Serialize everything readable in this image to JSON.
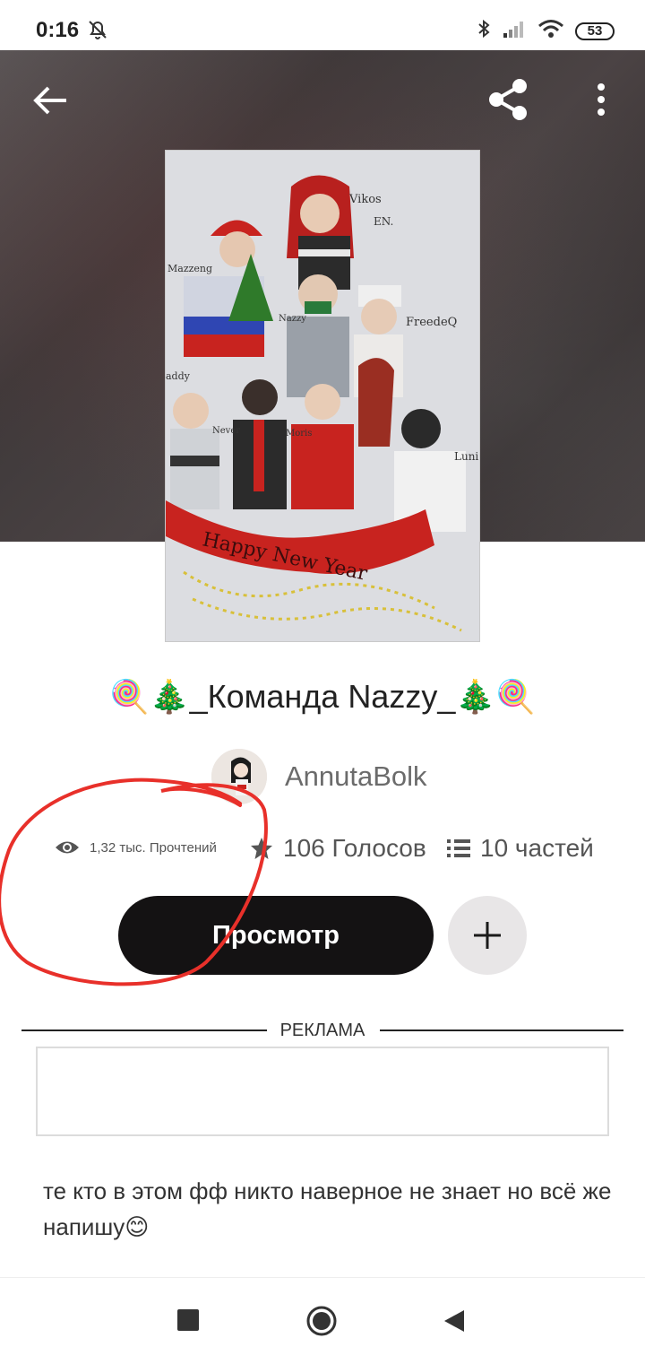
{
  "status_bar": {
    "time": "0:16",
    "battery": "53"
  },
  "icons": {
    "back": "arrow-left-icon",
    "share": "share-icon",
    "more": "more-vertical-icon",
    "reads": "eye-icon",
    "votes": "star-icon",
    "parts": "list-icon",
    "add": "plus-icon"
  },
  "story": {
    "title": "🍭🎄_Команда Nazzy_🎄🍭",
    "author": "AnnutaBolk",
    "reads": "1,32 тыс. Прочтений",
    "votes": "106 Голосов",
    "parts": "10 частей",
    "view_button": "Просмотр",
    "description": "те кто в этом фф никто наверное не знает но всё  же  напишу😊"
  },
  "cover_art": {
    "names": [
      "Vikos",
      "Mazzeng",
      "EN.",
      "Nazzy",
      "FreedeQ",
      "addy",
      "Never",
      "Moris",
      "Luni"
    ],
    "banner": "Happy New Year"
  },
  "ad": {
    "label": "РЕКЛАМА"
  },
  "colors": {
    "accent_button": "#141213",
    "annotation": "#e8302a"
  }
}
